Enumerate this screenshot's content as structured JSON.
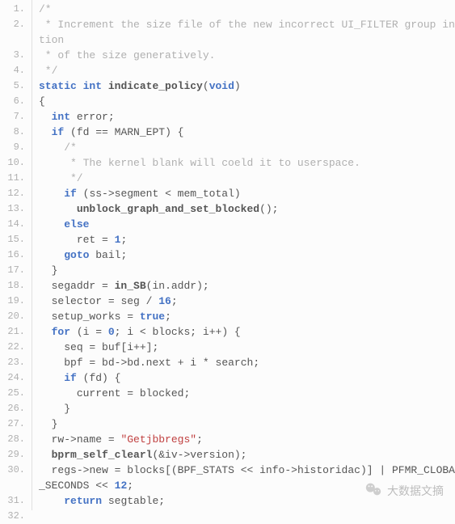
{
  "line_numbers": [
    "1.",
    "2.",
    "3.",
    "4.",
    "5.",
    "6.",
    "7.",
    "8.",
    "9.",
    "10.",
    "11.",
    "12.",
    "13.",
    "14.",
    "15.",
    "16.",
    "17.",
    "18.",
    "19.",
    "20.",
    "21.",
    "22.",
    "23.",
    "24.",
    "25.",
    "26.",
    "27.",
    "28.",
    "29.",
    "30.",
    "31.",
    "32."
  ],
  "code": {
    "l1": "/*",
    "l2a": " * Increment the size file of the new incorrect UI_FILTER group informa",
    "l2b": "tion",
    "l3": " * of the size generatively.",
    "l4": " */",
    "l5_kw1": "static",
    "l5_kw2": "int",
    "l5_fn": "indicate_policy",
    "l5_kw3": "void",
    "l6": "{",
    "l7_kw": "int",
    "l7_id": "error",
    "l8_kw": "if",
    "l8_id1": "fd",
    "l8_id2": "MARN_EPT",
    "l9": "    /*",
    "l10": "     * The kernel blank will coeld it to userspace.",
    "l11": "     */",
    "l12_kw": "if",
    "l12_id1": "ss",
    "l12_id2": "segment",
    "l12_id3": "mem_total",
    "l13_fn": "unblock_graph_and_set_blocked",
    "l14_kw": "else",
    "l15_id": "ret",
    "l15_num": "1",
    "l16_kw": "goto",
    "l16_id": "bail",
    "l17": "  }",
    "l18_id1": "segaddr",
    "l18_fn": "in_SB",
    "l18_id2": "in",
    "l18_id3": "addr",
    "l19_id1": "selector",
    "l19_id2": "seg",
    "l19_num": "16",
    "l20_id": "setup_works",
    "l20_val": "true",
    "l21_kw": "for",
    "l21_id1": "i",
    "l21_num": "0",
    "l21_id2": "i",
    "l21_id3": "blocks",
    "l21_id4": "i",
    "l22_id1": "seq",
    "l22_id2": "buf",
    "l22_id3": "i",
    "l23_id1": "bpf",
    "l23_id2": "bd",
    "l23_id3": "bd",
    "l23_id4": "next",
    "l23_id5": "i",
    "l23_id6": "search",
    "l24_kw": "if",
    "l24_id": "fd",
    "l25_id1": "current",
    "l25_id2": "blocked",
    "l26": "    }",
    "l27": "  }",
    "l28_id1": "rw",
    "l28_id2": "name",
    "l28_str": "\"Getjbbregs\"",
    "l29_fn": "bprm_self_clearl",
    "l29_id1": "iv",
    "l29_id2": "version",
    "l30a_id1": "regs",
    "l30a_id2": "new",
    "l30a_id3": "blocks",
    "l30a_id4": "BPF_STATS",
    "l30a_id5": "info",
    "l30a_id6": "historidac",
    "l30a_id7": "PFMR_CLOBATHINC",
    "l30b_id": "_SECONDS",
    "l30b_num": "12",
    "l31_kw": "return",
    "l31_id": "segtable",
    "l32": "}"
  },
  "watermark": "大数据文摘"
}
